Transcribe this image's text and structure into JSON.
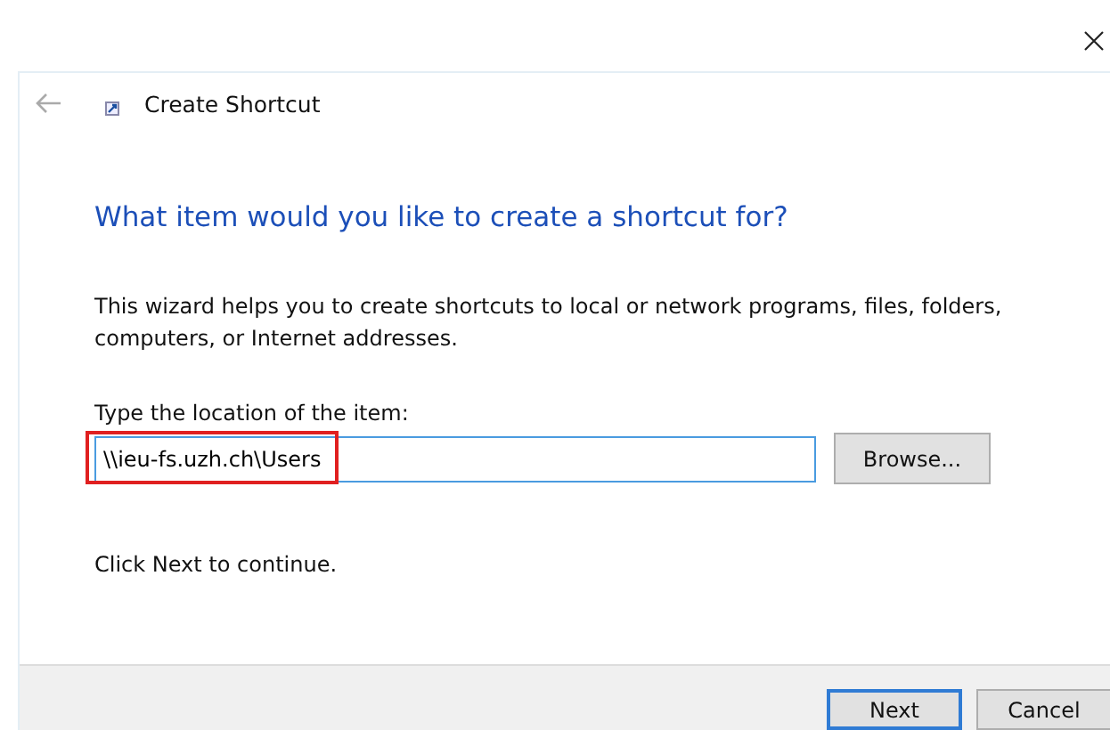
{
  "window": {
    "title": "Create Shortcut"
  },
  "heading": "What item would you like to create a shortcut for?",
  "description": "This wizard helps you to create shortcuts to local or network programs, files, folders, computers, or Internet addresses.",
  "location": {
    "label": "Type the location of the item:",
    "value": "\\\\ieu-fs.uzh.ch\\Users",
    "highlighted": true
  },
  "browse_button": "Browse...",
  "hint": "Click Next to continue.",
  "buttons": [
    {
      "label": "Next",
      "selected": true
    },
    {
      "label": "Cancel",
      "selected": false
    }
  ]
}
